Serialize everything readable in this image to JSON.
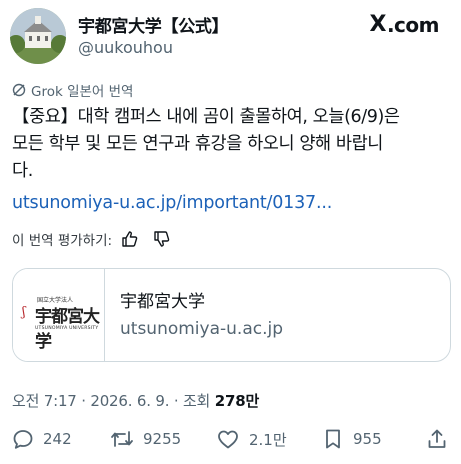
{
  "header": {
    "display_name": "宇都宮大学【公式】",
    "handle": "@uukouhou",
    "platform": "X",
    "platform_suffix": ".com"
  },
  "grok": {
    "label": "Grok 일본어 번역"
  },
  "tweet": {
    "line1": "【중요】대학 캠퍼스 내에 곰이 출몰하여, 오늘(6/9)은",
    "line2": "모든 학부 및 모든 연구과 휴강을 하오니 양해 바랍니",
    "line3": "다.",
    "link": "utsunomiya-u.ac.jp/important/0137..."
  },
  "rate": {
    "label": "이 번역 평가하기:"
  },
  "card": {
    "logo_small": "国立大学法人",
    "logo_big": "宇都宮大学",
    "logo_english": "UTSUNOMIYA UNIVERSITY",
    "title": "宇都宮大学",
    "domain": "utsunomiya-u.ac.jp"
  },
  "meta": {
    "time_date": "오전 7:17 · 2026. 6. 9. · 조회 ",
    "views": "278만"
  },
  "actions": {
    "replies": "242",
    "reposts": "9255",
    "likes": "2.1만",
    "bookmarks": "955"
  },
  "colors": {
    "link": "#1d62b8",
    "secondary": "#536471",
    "border": "#cfd9de"
  }
}
